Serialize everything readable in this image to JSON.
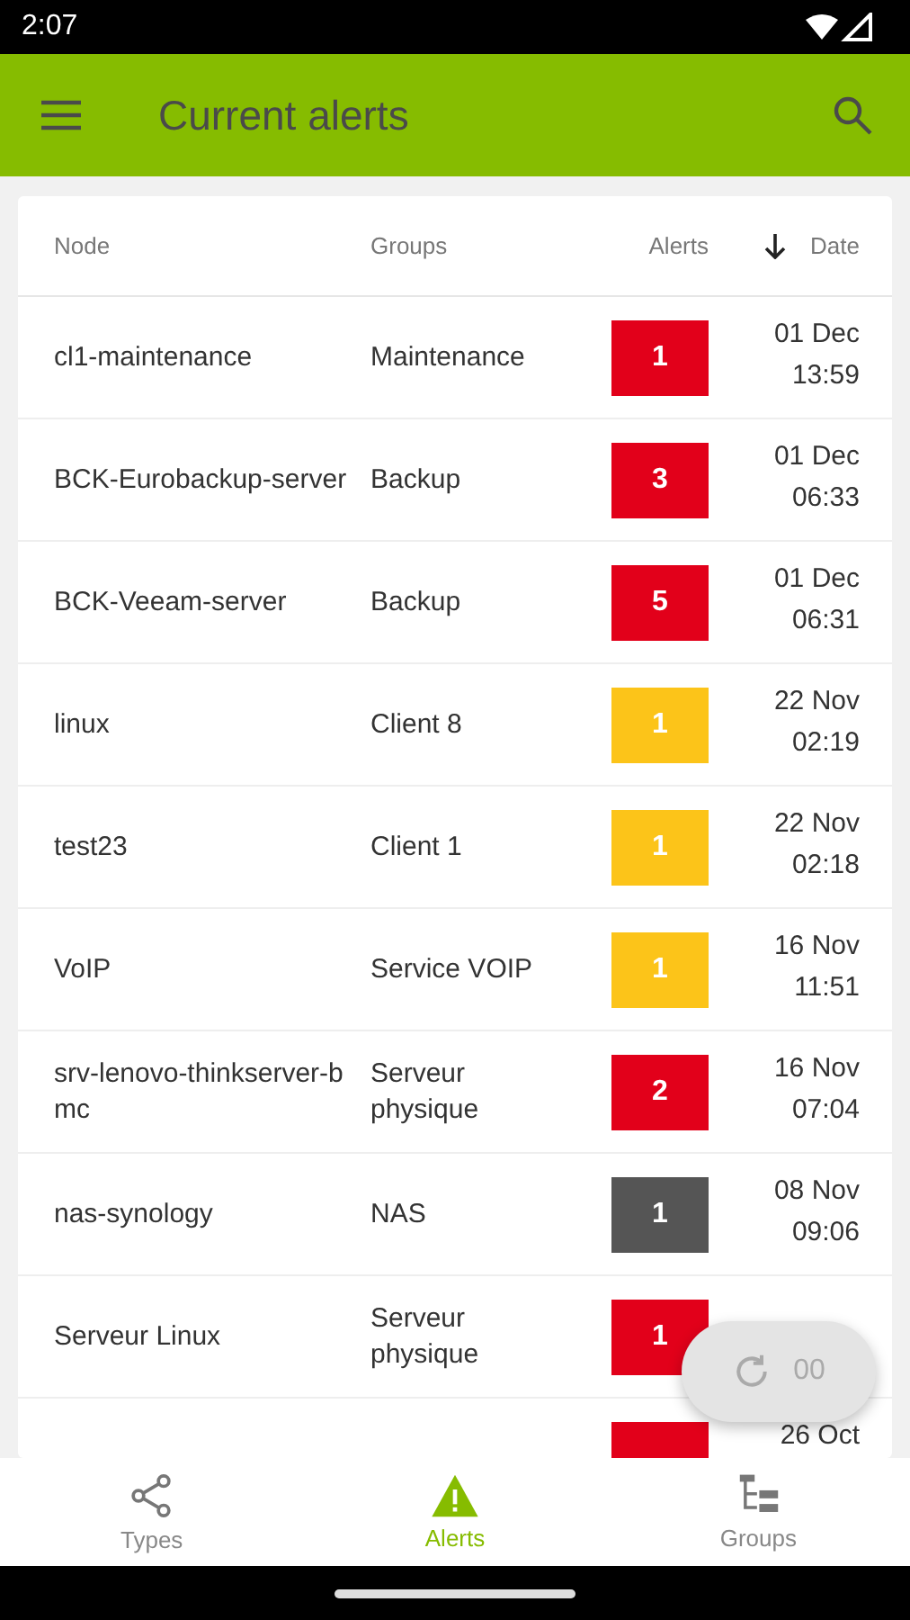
{
  "status_bar": {
    "time": "2:07"
  },
  "app_bar": {
    "title": "Current alerts"
  },
  "table": {
    "columns": [
      {
        "label": "Node",
        "sorted": false
      },
      {
        "label": "Groups",
        "sorted": false
      },
      {
        "label": "Alerts",
        "sorted": false
      },
      {
        "label": "Date",
        "sorted": true
      }
    ],
    "rows": [
      {
        "node": "cl1-maintenance",
        "group": "Maintenance",
        "alerts": "1",
        "color": "#e2001a",
        "date": "01 Dec",
        "time": "13:59"
      },
      {
        "node": "BCK-Eurobackup-server",
        "group": "Backup",
        "alerts": "3",
        "color": "#e2001a",
        "date": "01 Dec",
        "time": "06:33"
      },
      {
        "node": "BCK-Veeam-server",
        "group": "Backup",
        "alerts": "5",
        "color": "#e2001a",
        "date": "01 Dec",
        "time": "06:31"
      },
      {
        "node": "linux",
        "group": "Client 8",
        "alerts": "1",
        "color": "#fcc419",
        "date": "22 Nov",
        "time": "02:19"
      },
      {
        "node": "test23",
        "group": "Client 1",
        "alerts": "1",
        "color": "#fcc419",
        "date": "22 Nov",
        "time": "02:18"
      },
      {
        "node": "VoIP",
        "group": "Service VOIP",
        "alerts": "1",
        "color": "#fcc419",
        "date": "16 Nov",
        "time": "11:51"
      },
      {
        "node": "srv-lenovo-thinkserver-bmc",
        "group": "Serveur physique",
        "alerts": "2",
        "color": "#e2001a",
        "date": "16 Nov",
        "time": "07:04"
      },
      {
        "node": "nas-synology",
        "group": "NAS",
        "alerts": "1",
        "color": "#555555",
        "date": "08 Nov",
        "time": "09:06"
      },
      {
        "node": "Serveur Linux",
        "group": "Serveur physique",
        "alerts": "1",
        "color": "#e2001a"
      },
      {
        "color": "#e2001a",
        "date": "26 Oct"
      }
    ]
  },
  "refresh_button": {
    "label": "00"
  },
  "bottom_nav": [
    {
      "label": "Types",
      "selected": false
    },
    {
      "label": "Alerts",
      "selected": true
    },
    {
      "label": "Groups",
      "selected": false
    }
  ]
}
